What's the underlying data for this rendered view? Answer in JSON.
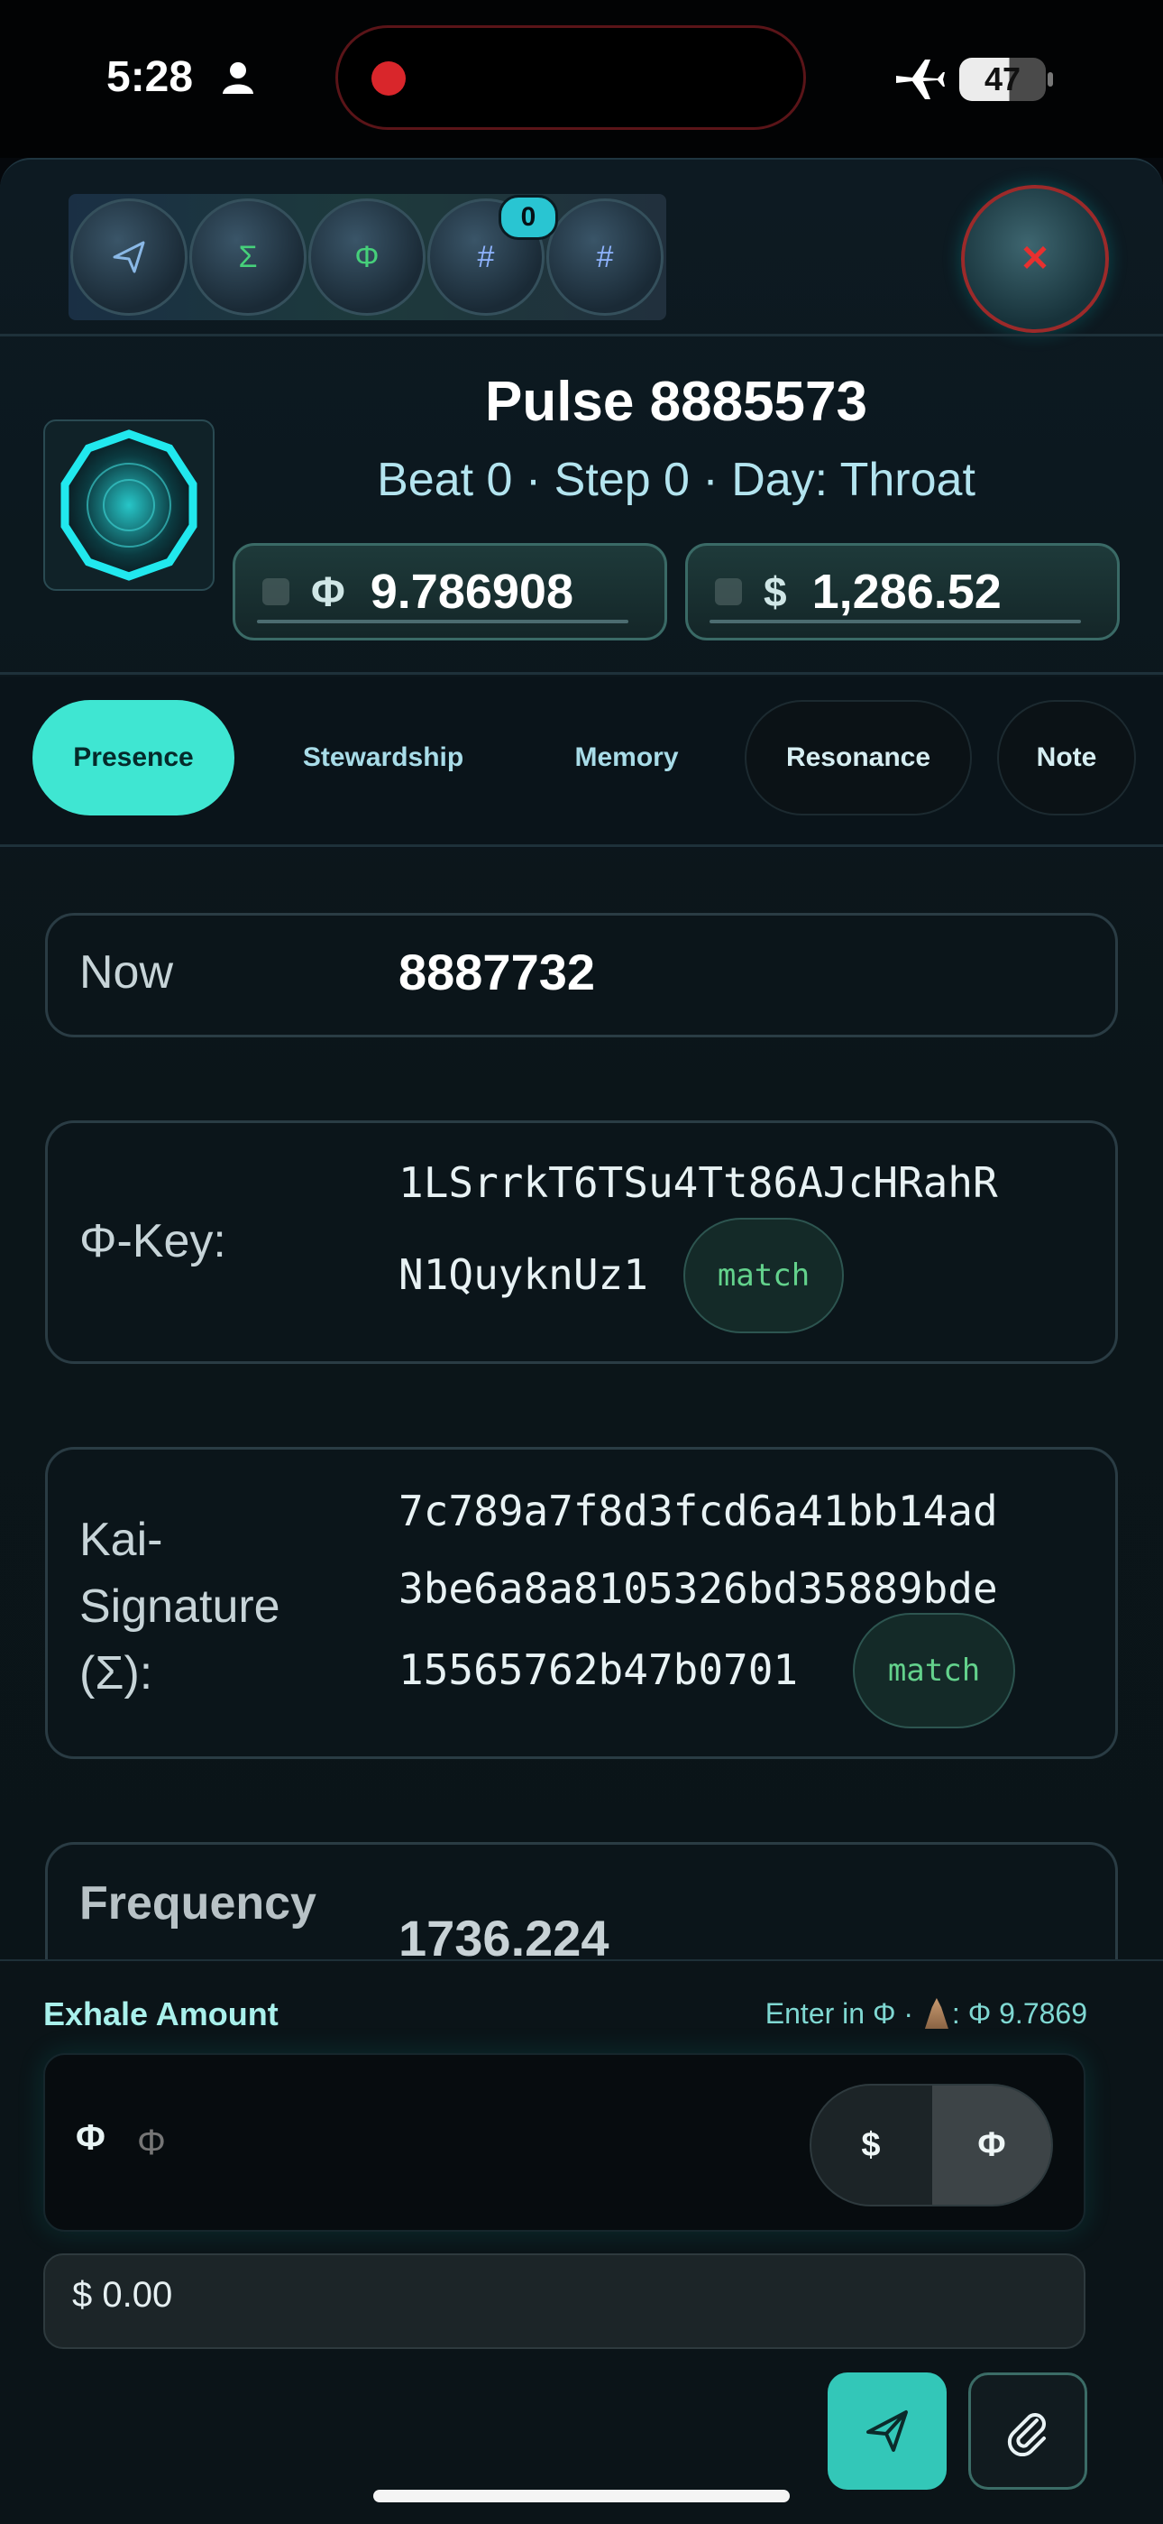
{
  "status_bar": {
    "time": "5:28",
    "battery": "47"
  },
  "toolbar": {
    "buttons": [
      {
        "icon": "send-icon",
        "glyph": "➤"
      },
      {
        "icon": "sigma-icon",
        "glyph": "Σ"
      },
      {
        "icon": "phi-icon",
        "glyph": "Φ"
      },
      {
        "icon": "hash-icon",
        "glyph": "#"
      },
      {
        "icon": "hash-icon",
        "glyph": "#"
      }
    ],
    "badge": "0",
    "close_glyph": "✕"
  },
  "header": {
    "title": "Pulse 8885573",
    "subtitle": "Beat 0 · Step 0 · Day: Throat",
    "phi_symbol": "Φ",
    "phi_value": "9.786908",
    "usd_symbol": "$",
    "usd_value": "1,286.52"
  },
  "tabs": [
    "Presence",
    "Stewardship",
    "Memory",
    "Resonance",
    "Note"
  ],
  "rows": {
    "now_label": "Now",
    "now_value": "8887732",
    "key_label": "Φ-Key:",
    "key_line1": "1LSrrkT6TSu4Tt86AJcHRahR",
    "key_line2": "N1QuyknUz1",
    "sig_label_1": "Kai-",
    "sig_label_2": "Signature",
    "sig_label_3": "(Σ):",
    "sig_line1": "7c789a7f8d3fcd6a41bb14ad",
    "sig_line2": "3be6a8a8105326bd35889bde",
    "sig_line3": "15565762b47b0701",
    "match_label": "match",
    "freq_label": "Frequency",
    "freq_value": "1736.224"
  },
  "exhale": {
    "label": "Exhale Amount",
    "hint_prefix": "Enter in Φ · ",
    "hint_suffix": ": Φ 9.7869",
    "input_symbol": "Φ",
    "input_placeholder": "Φ",
    "toggle_usd": "$",
    "toggle_phi": "Φ",
    "usd_equiv": "$ 0.00"
  },
  "colors": {
    "accent": "#3fe6d2",
    "background": "#0a1418",
    "close": "#e8302f",
    "match": "#63d28c"
  }
}
